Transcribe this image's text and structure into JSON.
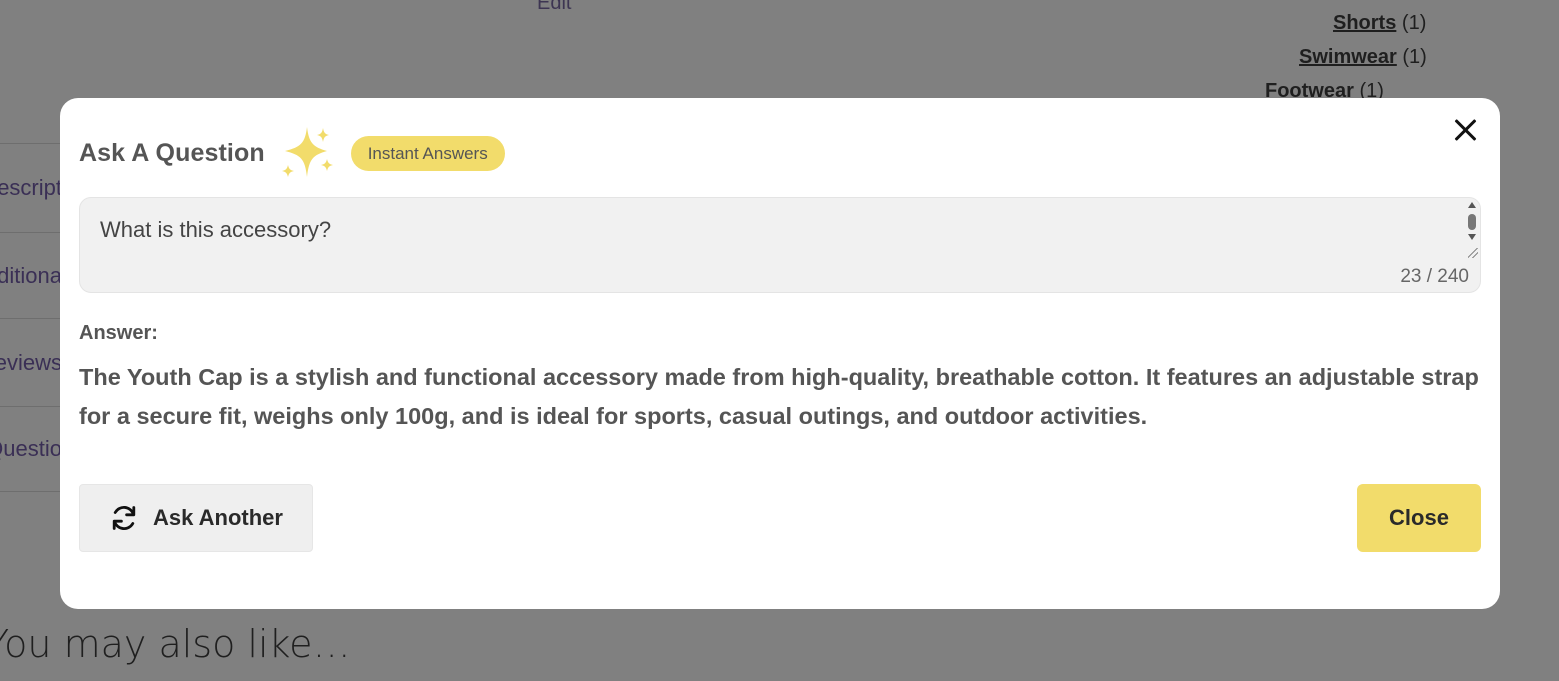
{
  "background": {
    "edit_link": "Edit",
    "categories": [
      {
        "label": "Shorts",
        "count": "(1)"
      },
      {
        "label": "Swimwear",
        "count": "(1)"
      },
      {
        "label": "Footwear",
        "count": "(1)"
      }
    ],
    "tabs": [
      "Descript",
      "Additiona",
      "Reviews",
      "Questio"
    ],
    "related_heading": "You may also like…"
  },
  "modal": {
    "title": "Ask A Question",
    "badge": "Instant Answers",
    "icons": [
      "sparkle-icon",
      "close-icon",
      "refresh-icon"
    ],
    "question": {
      "value": "What is this accessory?",
      "counter": "23 / 240"
    },
    "answer_label": "Answer:",
    "answer_text": "The Youth Cap is a stylish and functional accessory made from high-quality, breathable cotton. It features an adjustable strap for a secure fit, weighs only 100g, and is ideal for sports, casual outings, and outdoor activities.",
    "ask_another_label": "Ask Another",
    "close_label": "Close"
  },
  "colors": {
    "accent_yellow": "#f2dc6b",
    "overlay": "#808080",
    "modal_bg": "#ffffff"
  }
}
